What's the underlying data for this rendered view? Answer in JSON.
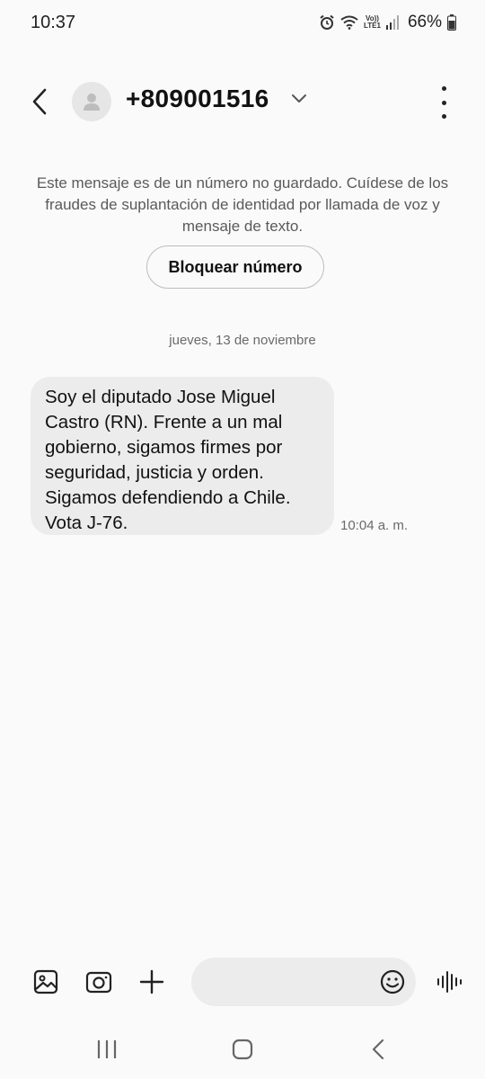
{
  "status_bar": {
    "time": "10:37",
    "battery": "66%",
    "lte_line1": "Vo))",
    "lte_line2": "LTE1",
    "icons": [
      "alarm-icon",
      "wifi-icon",
      "lte-icon",
      "signal-icon",
      "battery-icon"
    ]
  },
  "header": {
    "contact_number": "+809001516",
    "icons": [
      "back-arrow-icon",
      "person-icon",
      "chevron-down-icon",
      "more-vert-icon"
    ]
  },
  "notice": {
    "text": "Este mensaje es de un número no guardado. Cuídese de los fraudes de suplantación de identidad por llamada de voz y mensaje de texto.",
    "block_button_label": "Bloquear número"
  },
  "conversation": {
    "date_label": "jueves, 13 de noviembre",
    "messages": [
      {
        "text": "Soy el diputado Jose Miguel\nCastro (RN). Frente a un mal\ngobierno, sigamos firmes por\nseguridad, justicia y orden.\nSigamos defendiendo a Chile.\nVota J-76.",
        "time": "10:04 a. m."
      }
    ]
  },
  "composer": {
    "input_value": "",
    "input_placeholder": "",
    "icons": [
      "gallery-icon",
      "camera-icon",
      "plus-icon",
      "emoji-icon",
      "voice-icon"
    ]
  },
  "navbar": {
    "icons": [
      "recent-apps-icon",
      "home-icon",
      "back-icon"
    ]
  },
  "colors": {
    "background": "#fafafa",
    "bubble": "#ececec",
    "text_secondary": "#6a6a6a"
  }
}
